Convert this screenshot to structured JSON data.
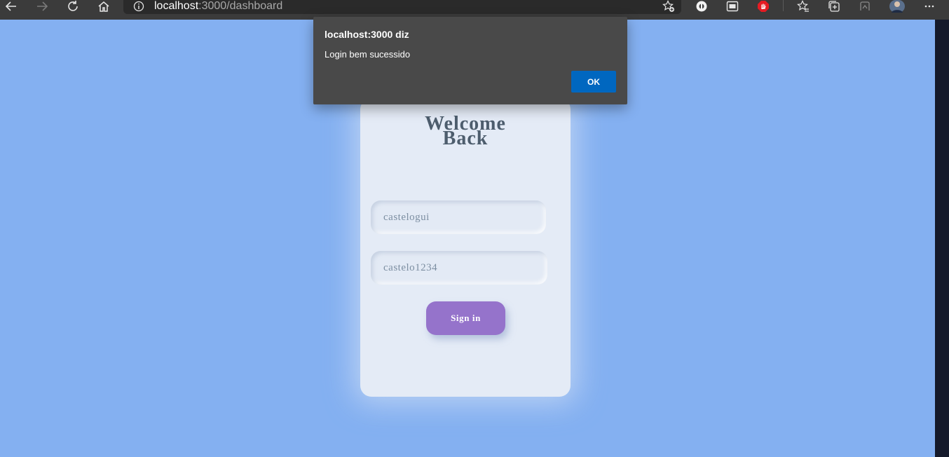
{
  "browser": {
    "url_host": "localhost",
    "url_rest": ":3000/dashboard",
    "icons": [
      "back-arrow-icon",
      "forward-arrow-icon",
      "reload-icon",
      "home-icon",
      "info-icon",
      "add-favorite-icon",
      "extension-icon",
      "picture-in-picture-icon",
      "adblock-icon",
      "favorites-icon",
      "collections-icon",
      "performance-icon",
      "profile-avatar",
      "more-icon"
    ]
  },
  "dialog": {
    "title": "localhost:3000 diz",
    "message": "Login bem sucessido",
    "ok_label": "OK"
  },
  "login": {
    "title_line1": "Welcome",
    "title_line2": "Back",
    "username_value": "castelogui",
    "password_value": "castelo1234",
    "signin_label": "Sign in"
  },
  "colors": {
    "page_background": "#84b0f1",
    "card_background": "#e4ebf6",
    "button_purple": "#9573cb",
    "dialog_background": "#494949",
    "dialog_ok": "#0067c0"
  }
}
